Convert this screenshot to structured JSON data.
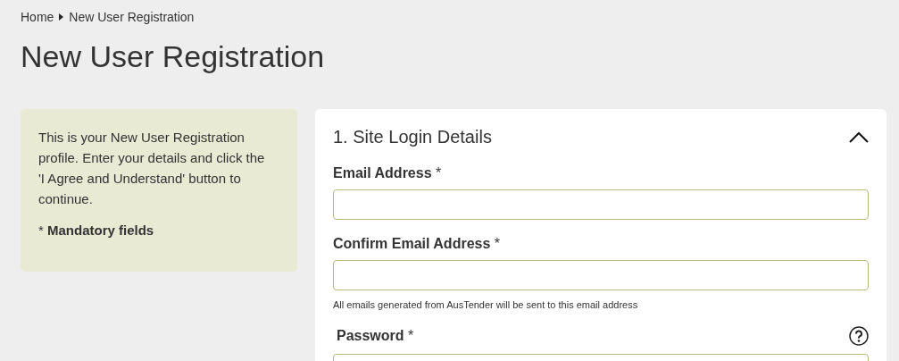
{
  "breadcrumb": [
    {
      "label": "Home"
    },
    {
      "label": "New User Registration"
    }
  ],
  "title": "New User Registration",
  "info": {
    "text": "This is your New User Registration profile. Enter your details and click the 'I Agree and Understand' button to continue.",
    "note": "* **Mandatory fields**"
  },
  "section": {
    "title": "1. Site Login Details",
    "expanded": true,
    "fields": [
      {
        "label": "Email Address",
        "required": "*",
        "help": false
      },
      {
        "label": "Confirm Email Address",
        "required": "*",
        "hint": "All emails generated from AusTender will be sent to this email address",
        "help": false
      },
      {
        "label": "Password",
        "required": "*",
        "help": true
      }
    ]
  }
}
